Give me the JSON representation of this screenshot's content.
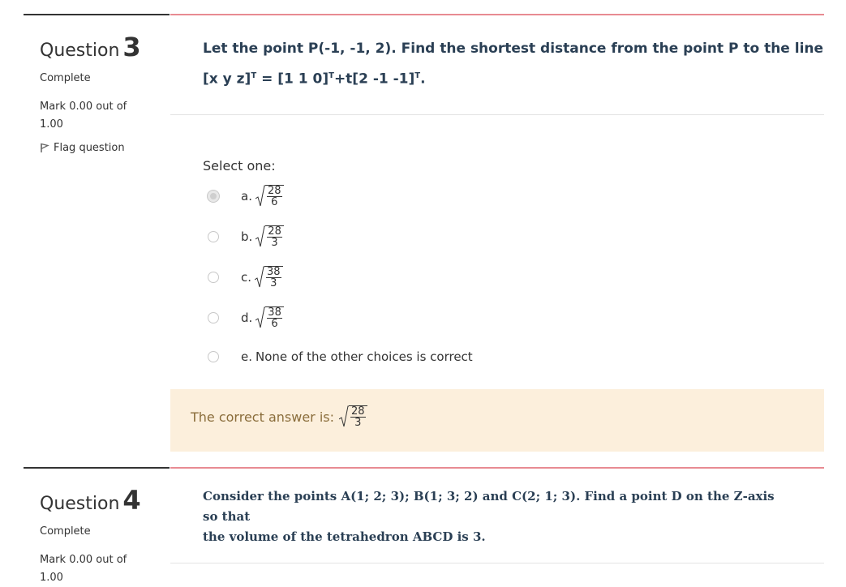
{
  "q3": {
    "label": "Question",
    "number": "3",
    "state": "Complete",
    "grade": "Mark 0.00 out of 1.00",
    "flag": "Flag question",
    "text_line1": "Let the point P(-1, -1, 2). Find the shortest distance from the point P to the line",
    "text_line2_a": "[x  y  z]",
    "text_line2_b": " = [1  1  0]",
    "text_line2_c": "+t[2  -1  -1]",
    "text_line2_d": ".",
    "sup": "T",
    "prompt": "Select one:",
    "options": [
      {
        "letter": "a.",
        "num": "28",
        "den": "6",
        "selected": true
      },
      {
        "letter": "b.",
        "num": "28",
        "den": "3",
        "selected": false
      },
      {
        "letter": "c.",
        "num": "38",
        "den": "3",
        "selected": false
      },
      {
        "letter": "d.",
        "num": "38",
        "den": "6",
        "selected": false
      },
      {
        "letter": "e.",
        "text": "None of the other choices is correct",
        "selected": false
      }
    ],
    "feedback_label": "The correct answer is:",
    "feedback_num": "28",
    "feedback_den": "3"
  },
  "q4": {
    "label": "Question",
    "number": "4",
    "state": "Complete",
    "grade": "Mark 0.00 out of 1.00",
    "text_line1": "Consider the points A(1; 2; 3); B(1; 3; 2) and C(2; 1; 3). Find a point D on the Z-axis",
    "text_line2": "so that",
    "text_line3": "the volume of the tetrahedron ABCD is 3."
  },
  "colors": {
    "accent_border": "#e88b92",
    "feedback_bg": "#fcefdc",
    "question_text": "#2a3f54"
  }
}
